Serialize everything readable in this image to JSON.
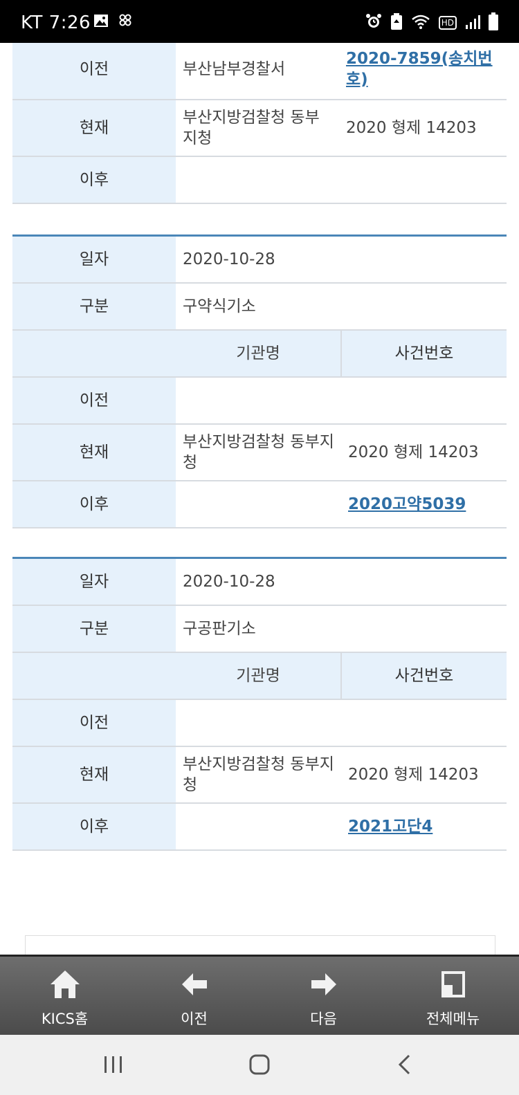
{
  "status": {
    "carrier_time": "KT 7:26",
    "icons": [
      "image-icon",
      "app-icon",
      "alarm-icon",
      "battery-saver-icon",
      "wifi-icon",
      "hd-icon",
      "signal-icon",
      "battery-icon"
    ],
    "hd": "HD"
  },
  "sections": [
    {
      "rows": [
        {
          "label": "이전",
          "org": "부산남부경찰서",
          "case": "2020-7859(송치번호)",
          "case_is_link": true
        },
        {
          "label": "현재",
          "org": "부산지방검찰청 동부지청",
          "case": "2020 형제 14203",
          "case_is_link": false
        },
        {
          "label": "이후",
          "org": "",
          "case": "",
          "case_is_link": false
        }
      ]
    },
    {
      "date_label": "일자",
      "date": "2020-10-28",
      "type_label": "구분",
      "type": "구약식기소",
      "col_org": "기관명",
      "col_case": "사건번호",
      "rows": [
        {
          "label": "이전",
          "org": "",
          "case": "",
          "case_is_link": false
        },
        {
          "label": "현재",
          "org": "부산지방검찰청 동부지청",
          "case": "2020 형제 14203",
          "case_is_link": false
        },
        {
          "label": "이후",
          "org": "",
          "case": "2020고약5039",
          "case_is_link": true
        }
      ]
    },
    {
      "date_label": "일자",
      "date": "2020-10-28",
      "type_label": "구분",
      "type": "구공판기소",
      "col_org": "기관명",
      "col_case": "사건번호",
      "rows": [
        {
          "label": "이전",
          "org": "",
          "case": "",
          "case_is_link": false
        },
        {
          "label": "현재",
          "org": "부산지방검찰청 동부지청",
          "case": "2020 형제 14203",
          "case_is_link": false
        },
        {
          "label": "이후",
          "org": "",
          "case": "2021고단4",
          "case_is_link": true
        }
      ]
    }
  ],
  "toolbar": {
    "home_label": "KICS홈",
    "prev_label": "이전",
    "next_label": "다음",
    "menu_label": "전체메뉴"
  },
  "navbar": {
    "icons": [
      "recent-apps-icon",
      "home-icon",
      "back-icon"
    ]
  },
  "colors": {
    "label_bg": "#e6f1fb",
    "link": "#2f6fa6",
    "section_rule": "#4a86b8",
    "toolbar": "#5a5a5a"
  }
}
